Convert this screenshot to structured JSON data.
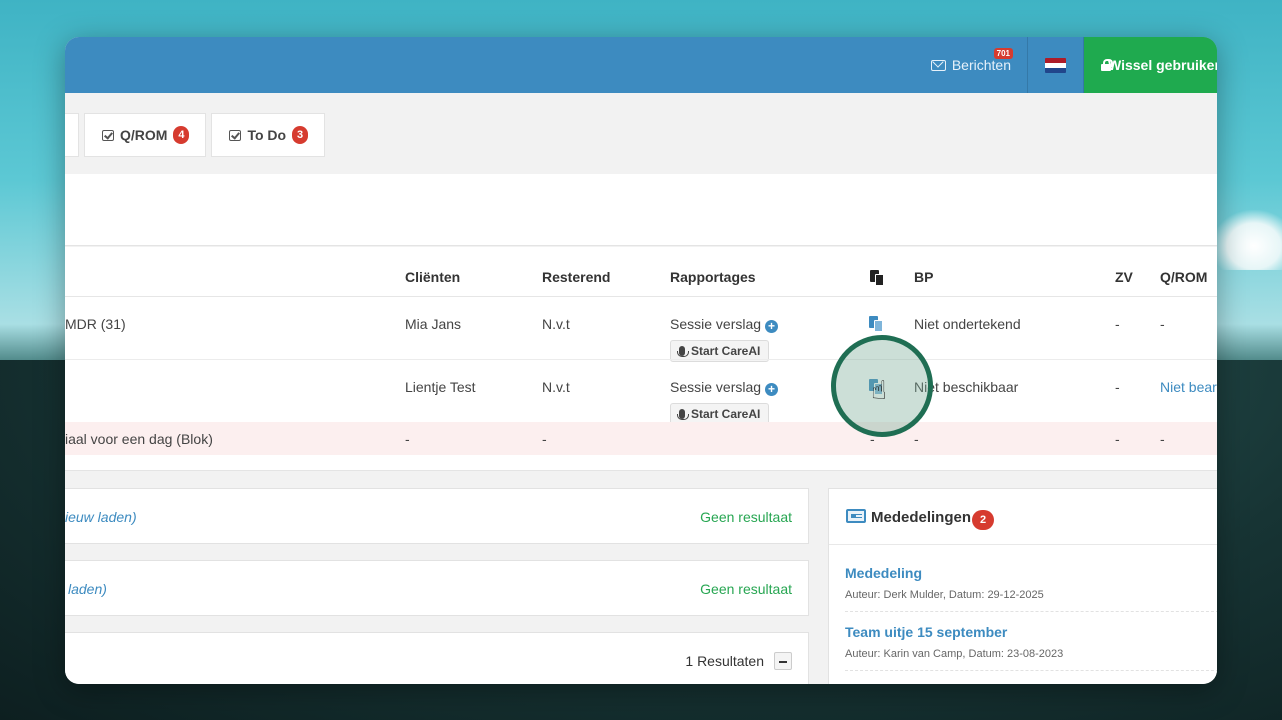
{
  "topbar": {
    "messages_label": "Berichten",
    "messages_count": "701",
    "switch_user_label": "Wissel gebruiker",
    "flag_colors": [
      "#ae1c28",
      "#ffffff",
      "#21468b"
    ],
    "bar_color": "#3d8bc0",
    "switch_color": "#1faa4f"
  },
  "tabs": [
    {
      "label": "Q/ROM",
      "badge": "4",
      "icon": "checkbox-icon"
    },
    {
      "label": "To Do",
      "badge": "3",
      "icon": "checkbox-icon"
    }
  ],
  "table": {
    "headers": {
      "clienten": "Cliënten",
      "resterend": "Resterend",
      "rapportages": "Rapportages",
      "copy": "copy-icon",
      "bp": "BP",
      "zv": "ZV",
      "qrom": "Q/ROM"
    },
    "rows": [
      {
        "name": "MDR (31)",
        "client": "Mia Jans",
        "resterend": "N.v.t",
        "rapportage": "Sessie verslag",
        "careai": "Start CareAI",
        "bp": "Niet ondertekend",
        "zv": "-",
        "qrom": "-"
      },
      {
        "name": "",
        "client": "Lientje Test",
        "resterend": "N.v.t",
        "rapportage": "Sessie verslag",
        "careai": "Start CareAI",
        "bp": "Niet beschikbaar",
        "zv": "-",
        "qrom": "Niet bearbeitet"
      },
      {
        "name": "iaal voor een dag (Blok)",
        "client": "-",
        "resterend": "-",
        "copy": "-",
        "bp": "-",
        "zv": "-",
        "qrom": "-"
      }
    ]
  },
  "cards": [
    {
      "link": "ieuw laden)",
      "status": "Geen resultaat"
    },
    {
      "link": "laden)",
      "status": "Geen resultaat"
    },
    {
      "count": "1 Resultaten"
    }
  ],
  "announcements": {
    "title": "Mededelingen",
    "badge": "2",
    "items": [
      {
        "title": "Mededeling",
        "meta": "Auteur: Derk Mulder, Datum: 29-12-2025"
      },
      {
        "title": "Team uitje 15 september",
        "meta": "Auteur: Karin van Camp, Datum: 23-08-2023"
      }
    ]
  }
}
